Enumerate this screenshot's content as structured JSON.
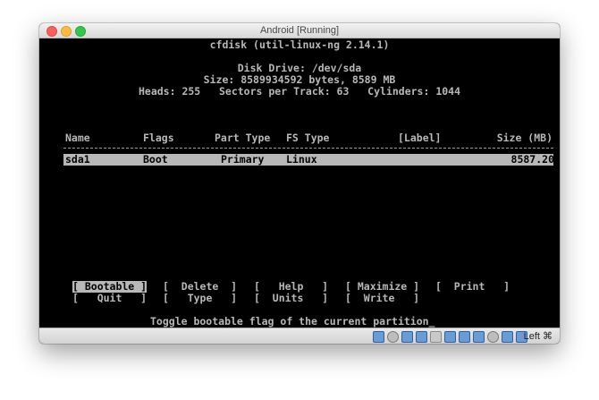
{
  "window": {
    "title": "Android [Running]"
  },
  "terminal": {
    "header": "cfdisk (util-linux-ng 2.14.1)",
    "disk_drive": "Disk Drive: /dev/sda",
    "size_line": "Size: 8589934592 bytes, 8589 MB",
    "geometry_line": "Heads: 255   Sectors per Track: 63   Cylinders: 1044",
    "columns": {
      "name": "Name",
      "flags": "Flags",
      "part_type": "Part Type",
      "fs_type": "FS Type",
      "label": "[Label]",
      "size": "Size (MB)"
    },
    "partitions": [
      {
        "name": "sda1",
        "flags": "Boot",
        "part_type": "Primary",
        "fs_type": "Linux",
        "label": "",
        "size": "8587.20"
      }
    ],
    "menu": {
      "bootable": "[ Bootable ]",
      "delete": "[  Delete  ]",
      "help": "[   Help   ]",
      "maximize": "[ Maximize ]",
      "print": "[  Print   ]",
      "quit": "[   Quit   ]",
      "type": "[   Type   ]",
      "units": "[  Units   ]",
      "write": "[  Write   ]"
    },
    "hint": "Toggle bootable flag of the current partition_"
  },
  "statusbar": {
    "host_key": "Left ⌘",
    "icons": [
      "hard-disk-icon",
      "optical-disk-icon",
      "usb-icon",
      "pencil-icon",
      "shared-folder-icon",
      "display-icon",
      "network-icon",
      "video-capture-icon",
      "cpu-icon",
      "mouse-integration-icon",
      "keyboard-icon"
    ]
  }
}
